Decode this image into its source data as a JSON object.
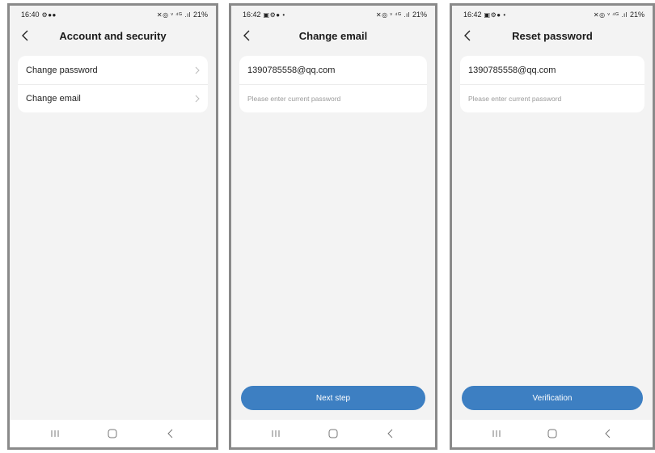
{
  "screens": [
    {
      "status": {
        "time": "16:40",
        "left_glyphs": "⚙●●",
        "right_glyphs": "✕◎ ᵛ ⁴ᴳ .ıl",
        "battery": "21%"
      },
      "header": {
        "title": "Account and security"
      },
      "menu": [
        {
          "label": "Change password"
        },
        {
          "label": "Change email"
        }
      ]
    },
    {
      "status": {
        "time": "16:42",
        "left_glyphs": "▣⚙● •",
        "right_glyphs": "✕◎ ᵛ ⁴ᴳ .ıl",
        "battery": "21%"
      },
      "header": {
        "title": "Change email"
      },
      "email": "1390785558@qq.com",
      "password_placeholder": "Please enter current password",
      "button": "Next step"
    },
    {
      "status": {
        "time": "16:42",
        "left_glyphs": "▣⚙● •",
        "right_glyphs": "✕◎ ᵛ ⁴ᴳ .ıl",
        "battery": "21%"
      },
      "header": {
        "title": "Reset password"
      },
      "email": "1390785558@qq.com",
      "password_placeholder": "Please enter current password",
      "button": "Verification"
    }
  ],
  "colors": {
    "accent": "#3d7fc2",
    "background": "#f3f3f3",
    "card": "#ffffff"
  },
  "icons": [
    "back-chevron-icon",
    "chevron-right-icon",
    "recent-apps-icon",
    "home-icon",
    "back-nav-icon"
  ]
}
